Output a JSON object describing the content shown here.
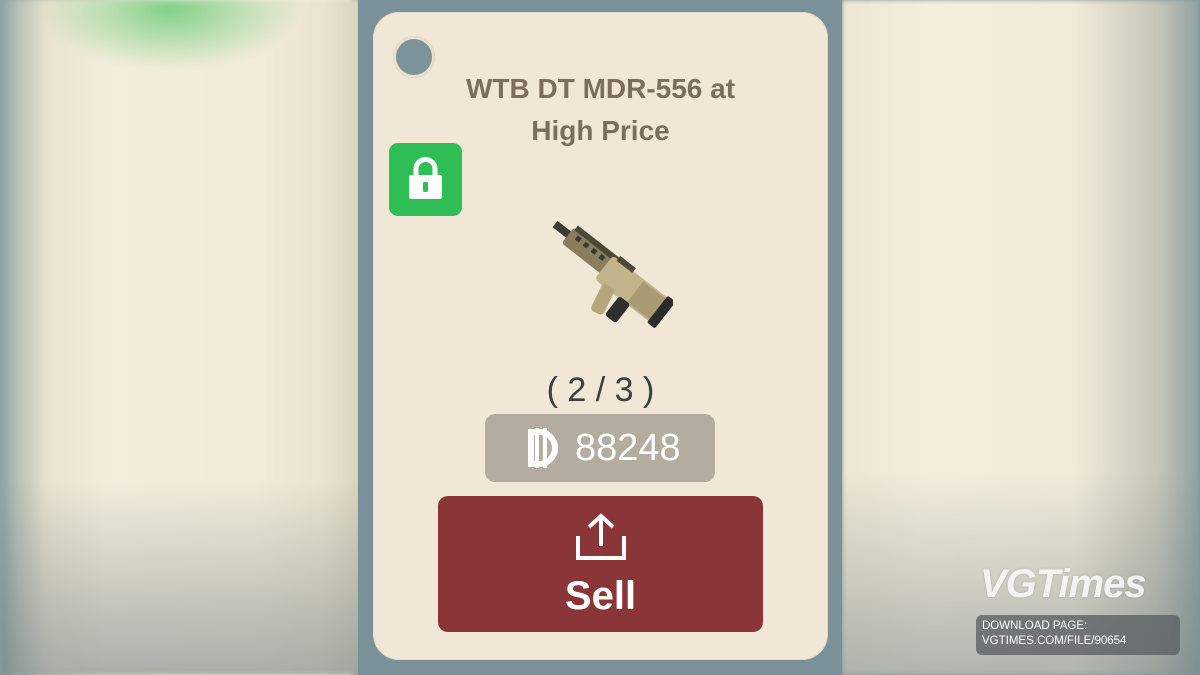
{
  "card": {
    "title": "WTB DT MDR-556 at High Price",
    "progress": "( 2 / 3 )",
    "price": {
      "currency_icon": "coin-currency-icon",
      "amount": "88248"
    },
    "item_icon": "mdr-556-rifle-icon",
    "lock_icon": "lock-icon"
  },
  "sell_button": {
    "icon": "share-upload-icon",
    "label": "Sell"
  },
  "watermark": {
    "brand": "VGTimes",
    "line1": "DOWNLOAD PAGE:",
    "line2": "VGTIMES.COM/FILE/90654"
  },
  "colors": {
    "card_bg": "#f0e7d6",
    "stage_bg": "#7a919a",
    "lock_green": "#2fbe56",
    "price_chip": "#b5aca0",
    "sell_red": "#8a3638",
    "title_text": "#7a6e5c"
  }
}
